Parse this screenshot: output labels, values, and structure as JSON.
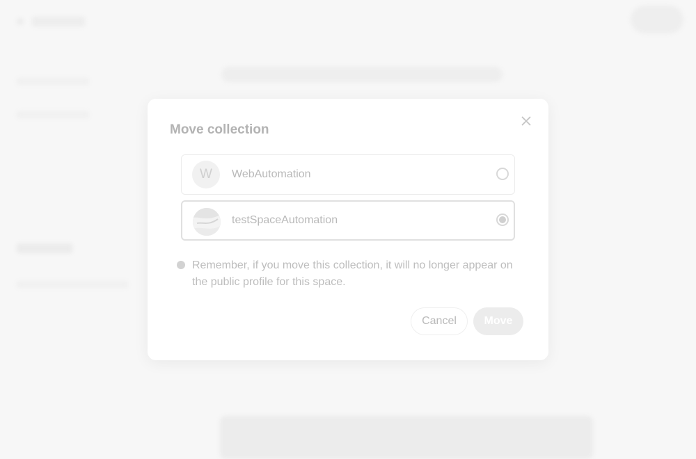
{
  "modal": {
    "title": "Move collection",
    "close_icon": "close-icon",
    "options": [
      {
        "initial": "W",
        "label": "WebAutomation",
        "selected": false
      },
      {
        "initial": "",
        "label": "testSpaceAutomation",
        "selected": true
      }
    ],
    "notice": "Remember, if you move this collection, it will no longer appear on the public profile for this space.",
    "cancel_label": "Cancel",
    "move_label": "Move"
  },
  "colors": {
    "backdrop": "#f7f7f7",
    "modal": "#ffffff",
    "move_button": "#ececec"
  }
}
